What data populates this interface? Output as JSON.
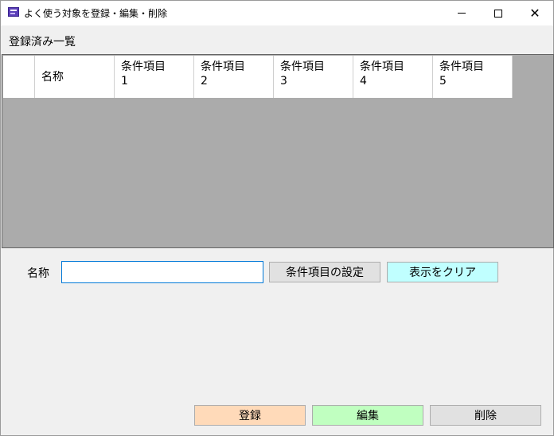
{
  "window": {
    "title": "よく使う対象を登録・編集・削除",
    "controls": {
      "minimize": "",
      "maximize": "",
      "close": "✕"
    }
  },
  "list_section": {
    "label": "登録済み一覧",
    "columns": [
      {
        "line1": "名称",
        "line2": ""
      },
      {
        "line1": "条件項目",
        "line2": "1"
      },
      {
        "line1": "条件項目",
        "line2": "2"
      },
      {
        "line1": "条件項目",
        "line2": "3"
      },
      {
        "line1": "条件項目",
        "line2": "4"
      },
      {
        "line1": "条件項目",
        "line2": "5"
      }
    ],
    "rows": []
  },
  "form": {
    "name_label": "名称",
    "name_value": "",
    "settings_button": "条件項目の設定",
    "clear_button": "表示をクリア"
  },
  "actions": {
    "register": "登録",
    "edit": "編集",
    "delete": "削除"
  },
  "colors": {
    "grid_background": "#ababab",
    "clear_button": "#c0ffff",
    "register_button": "#ffdab9",
    "edit_button": "#c0ffc0",
    "delete_button": "#e1e1e1",
    "input_focus_border": "#0078d7"
  },
  "icons": {
    "app": "app-icon",
    "minimize": "minimize-icon",
    "maximize": "maximize-icon",
    "close": "close-icon"
  }
}
